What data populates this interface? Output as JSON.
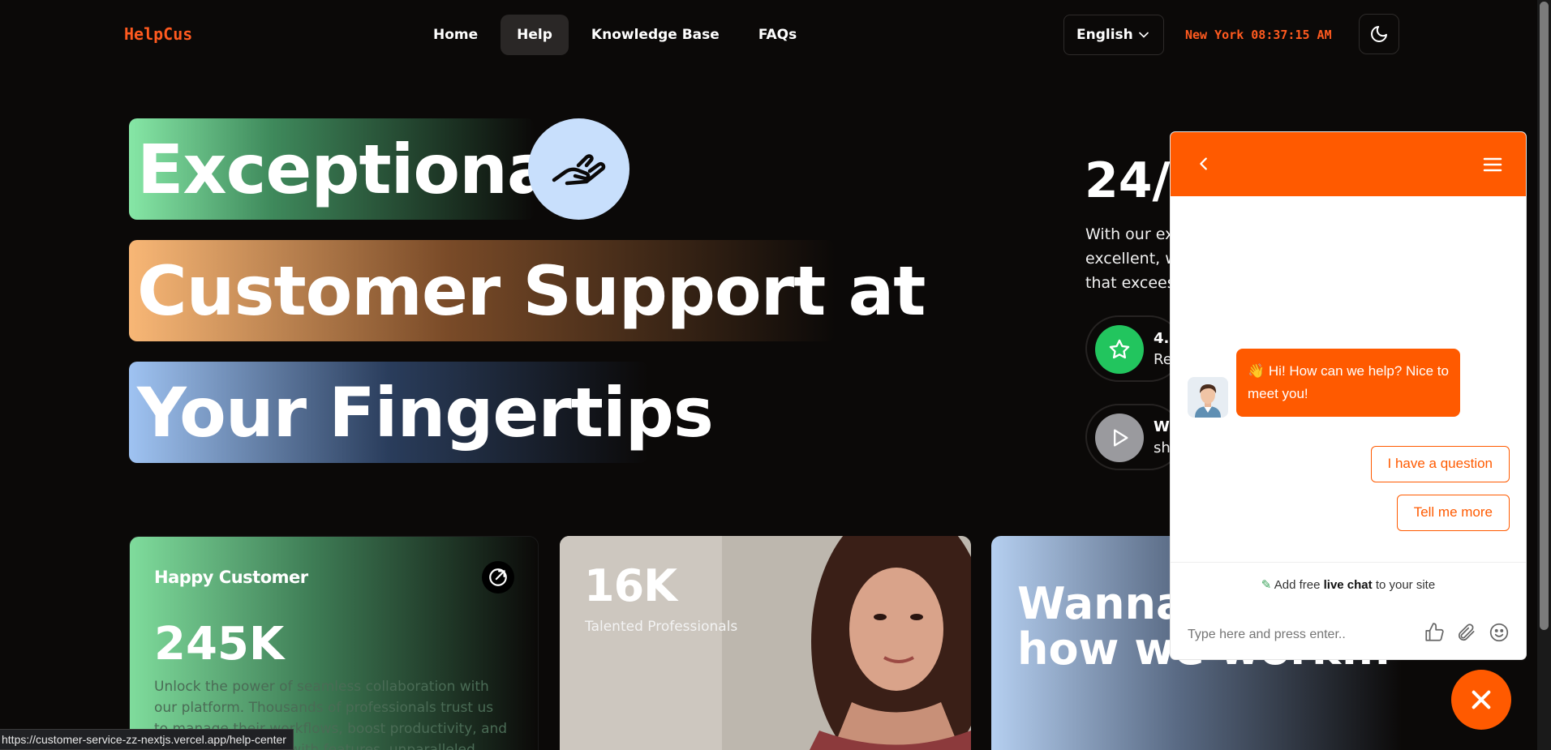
{
  "nav": {
    "logo": "HelpCus",
    "links": [
      "Home",
      "Help",
      "Knowledge Base",
      "FAQs"
    ],
    "active_index": 1,
    "language": "English",
    "clock_city": "New York",
    "clock_time": "08:37:15 AM"
  },
  "hero": {
    "line1": "Exceptional",
    "line2": "Customer Support at",
    "line3": "Your Fingertips"
  },
  "info": {
    "title": "24/7",
    "text_lines": [
      "With our exp",
      "excellent, we",
      "that excees"
    ],
    "rating_title": "4.5",
    "rating_sub": "Re",
    "video_title": "Wa",
    "video_sub": "sho"
  },
  "cards": {
    "happy_title": "Happy Customer",
    "happy_number": "245K",
    "happy_desc": "Unlock the power of seamless collaboration with our platform. Thousands of professionals trust us to manage their workflows, boost productivity, and achieve their goals with features, unparalleled support",
    "talent_number": "16K",
    "talent_label": "Talented Professionals",
    "wanna_line1": "Wanna",
    "wanna_line2": "how we work..."
  },
  "status_url": "https://customer-service-zz-nextjs.vercel.app/help-center",
  "chat": {
    "greeting": "👋 Hi! How can we help? Nice to meet you!",
    "option1": "I have a question",
    "option2": "Tell me more",
    "powered_prefix": "Add free",
    "powered_bold": "live chat",
    "powered_suffix": "to your site",
    "input_placeholder": "Type here and press enter.."
  },
  "colors": {
    "accent": "#ff5a00",
    "logo": "#ff5a1f",
    "background": "#0b0908"
  }
}
